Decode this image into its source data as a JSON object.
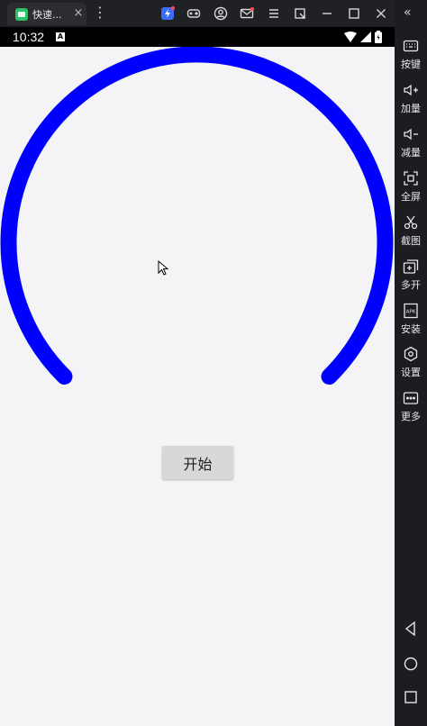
{
  "emulator": {
    "tab_title": "快速...",
    "tab_close": "×",
    "tab_menu": "⋮",
    "sidebar_collapse": "«",
    "sidebar": [
      {
        "label": "按键",
        "icon": "keyboard-icon"
      },
      {
        "label": "加量",
        "icon": "volume-up-icon"
      },
      {
        "label": "减量",
        "icon": "volume-down-icon"
      },
      {
        "label": "全屏",
        "icon": "fullscreen-icon"
      },
      {
        "label": "截图",
        "icon": "screenshot-icon"
      },
      {
        "label": "多开",
        "icon": "multi-instance-icon"
      },
      {
        "label": "安装",
        "icon": "install-apk-icon"
      },
      {
        "label": "设置",
        "icon": "settings-icon"
      },
      {
        "label": "更多",
        "icon": "more-icon"
      }
    ],
    "apk_text": "APK"
  },
  "status_bar": {
    "time": "10:32",
    "notification": "A"
  },
  "app": {
    "start_button_label": "开始",
    "arc_color": "#0000ff"
  }
}
